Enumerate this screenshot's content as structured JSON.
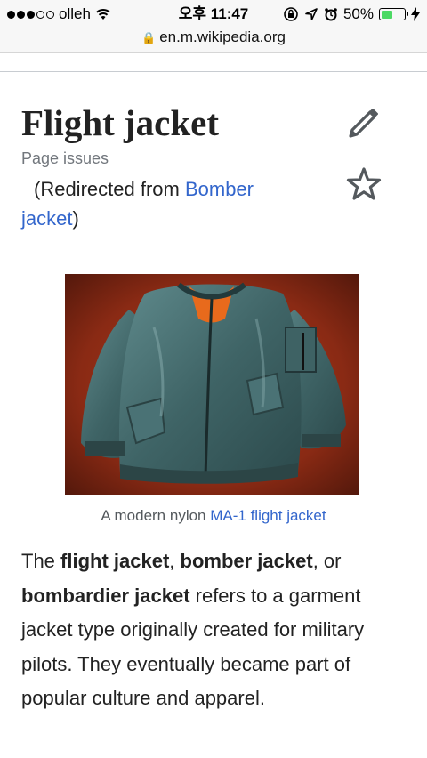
{
  "status_bar": {
    "carrier": "olleh",
    "time": "오후 11:47",
    "battery_percent": "50%",
    "battery_level": 0.5
  },
  "url_bar": {
    "domain": "en.m.wikipedia.org"
  },
  "article": {
    "title": "Flight jacket",
    "page_issues": "Page issues",
    "redirect_prefix": "(Redirected from ",
    "redirect_link": "Bomber jacket",
    "redirect_suffix": ")",
    "figure": {
      "caption_prefix": "A modern nylon ",
      "caption_link": "MA-1 flight jacket"
    },
    "paragraph": {
      "t1": "The ",
      "b1": "flight jacket",
      "t2": ", ",
      "b2": "bomber jacket",
      "t3": ", or ",
      "b3": "bombardier jacket",
      "t4": " refers to a garment jacket type originally created for military pilots. They eventually became part of popular culture and apparel."
    }
  },
  "icons": {
    "edit": "pencil-icon",
    "watch": "star-icon"
  },
  "colors": {
    "link": "#3366cc",
    "battery_fill": "#4cd964"
  }
}
